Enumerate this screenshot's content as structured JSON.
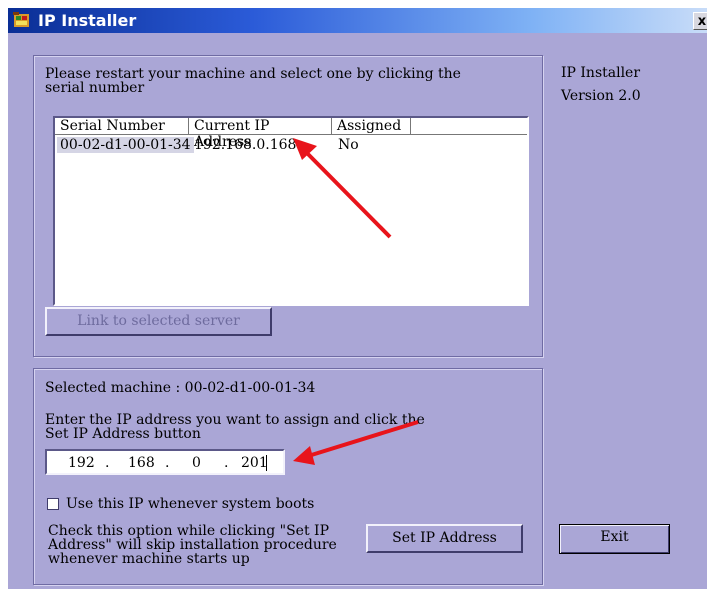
{
  "window": {
    "title": "IP Installer",
    "close_label": "x"
  },
  "server_list_panel": {
    "instruction": "Please restart your machine and select one by clicking the serial number",
    "instruction_line1": "Please restart your machine and select one by clicking the",
    "instruction_line2": "serial number",
    "columns": [
      "Serial Number",
      "Current IP Address",
      "Assigned"
    ],
    "rows": [
      {
        "serial": "00-02-d1-00-01-34",
        "ip": "192.168.0.168",
        "assigned": "No"
      }
    ],
    "link_button_label": "Link to selected server"
  },
  "info": {
    "app_name": "IP Installer",
    "version": "Version 2.0"
  },
  "assign_panel": {
    "selected_label": "Selected machine",
    "selected_value": "00-02-d1-00-01-34",
    "selected_text": "Selected machine  :  00-02-d1-00-01-34",
    "prompt_line1": "Enter the IP address you want to assign and click the",
    "prompt_line2": "Set IP Address button",
    "ip_octets": [
      "192",
      "168",
      "0",
      "201"
    ],
    "ip_separator": ".",
    "checkbox_label": "Use this IP whenever system boots",
    "checkbox_checked": false,
    "note_line1": "Check this option while clicking \"Set IP",
    "note_line2": "Address\" will skip installation procedure",
    "note_line3": "whenever machine starts up",
    "set_ip_button_label": "Set IP Address"
  },
  "exit_button_label": "Exit",
  "colors": {
    "window_bg": "#aaa6d6",
    "title_bar": "#0a2e95",
    "annotation_arrow": "#e8141b"
  }
}
